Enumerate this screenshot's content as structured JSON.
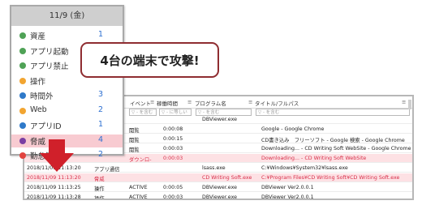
{
  "calendar": {
    "date_label": "11/9 (金)",
    "items": [
      {
        "label": "資産",
        "count": "1",
        "color": "#4fa256"
      },
      {
        "label": "アプリ起動",
        "count": "",
        "color": "#4fa256"
      },
      {
        "label": "アプリ禁止",
        "count": "",
        "color": "#4fa256"
      },
      {
        "label": "操作",
        "count": "",
        "color": "#f2a531"
      },
      {
        "label": "時間外",
        "count": "3",
        "color": "#2e79c9"
      },
      {
        "label": "Web",
        "count": "2",
        "color": "#f2a531"
      },
      {
        "label": "アプリID",
        "count": "1",
        "color": "#2e79c9"
      },
      {
        "label": "脅威",
        "count": "4",
        "color": "#7a3fa3"
      },
      {
        "label": "勤怠管理",
        "count": "2",
        "color": "#e2433f"
      }
    ]
  },
  "callout": {
    "text": "4台の端末で攻撃!"
  },
  "table": {
    "headers": {
      "event": "イベント",
      "duration": "稼働時間",
      "program": "プログラム名",
      "title": "タイトル/フルパス"
    },
    "filters": {
      "event": "▽ - を含む",
      "duration": "▽ - に等しい",
      "program": "▽ - を含む",
      "title": "▽ - を含む"
    },
    "rows": [
      {
        "time": "",
        "event": "",
        "type": "",
        "duration": "",
        "program": "DBViewer.exe",
        "title": "",
        "highlight": false
      },
      {
        "time": "",
        "event": "",
        "type": "閲覧",
        "duration": "0:00:08",
        "program": "",
        "title": "Google - Google Chrome",
        "highlight": false
      },
      {
        "time": "",
        "event": "",
        "type": "閲覧",
        "duration": "0:00:15",
        "program": "",
        "title": "CD書き込み　フリーソフト - Google 検索 - Google Chrome",
        "highlight": false
      },
      {
        "time": "",
        "event": "",
        "type": "閲覧",
        "duration": "0:00:03",
        "program": "",
        "title": "Downloading... - CD Writing Soft WebSite - Google Chrome",
        "highlight": false
      },
      {
        "time": "",
        "event": "",
        "type": "ダウンロ-",
        "duration": "0:00:03",
        "program": "",
        "title": "Downloading... - CD Writing Soft WebSite",
        "highlight": true
      },
      {
        "time": "2018/11/09 11:13:20",
        "event": "アプリ通信",
        "type": "",
        "duration": "",
        "program": "lsass.exe",
        "title": "C:¥Windows¥System32¥lsass.exe",
        "highlight": false
      },
      {
        "time": "2018/11/09 11:13:20",
        "event": "脅威",
        "type": "",
        "duration": "",
        "program": "CD Writing Soft.exe",
        "title": "C:¥Program Files¥CD Writing Soft¥CD Writing Soft.exe",
        "highlight": true
      },
      {
        "time": "2018/11/09 11:13:25",
        "event": "操作",
        "type": "ACTIVE",
        "duration": "0:00:05",
        "program": "DBViewer.exe",
        "title": "DBViewer Ver2.0.0.1",
        "highlight": false
      },
      {
        "time": "2018/11/09 11:13:28",
        "event": "操作",
        "type": "ACTIVE",
        "duration": "0:00:03",
        "program": "DBViewer.exe",
        "title": "DBViewer Ver2.0.0.1",
        "highlight": false
      }
    ]
  },
  "colors": {
    "accent_red": "#d72d48",
    "arrow_red": "#d0202a",
    "callout_border": "#8f2d31",
    "count_blue": "#2c6fd1"
  }
}
